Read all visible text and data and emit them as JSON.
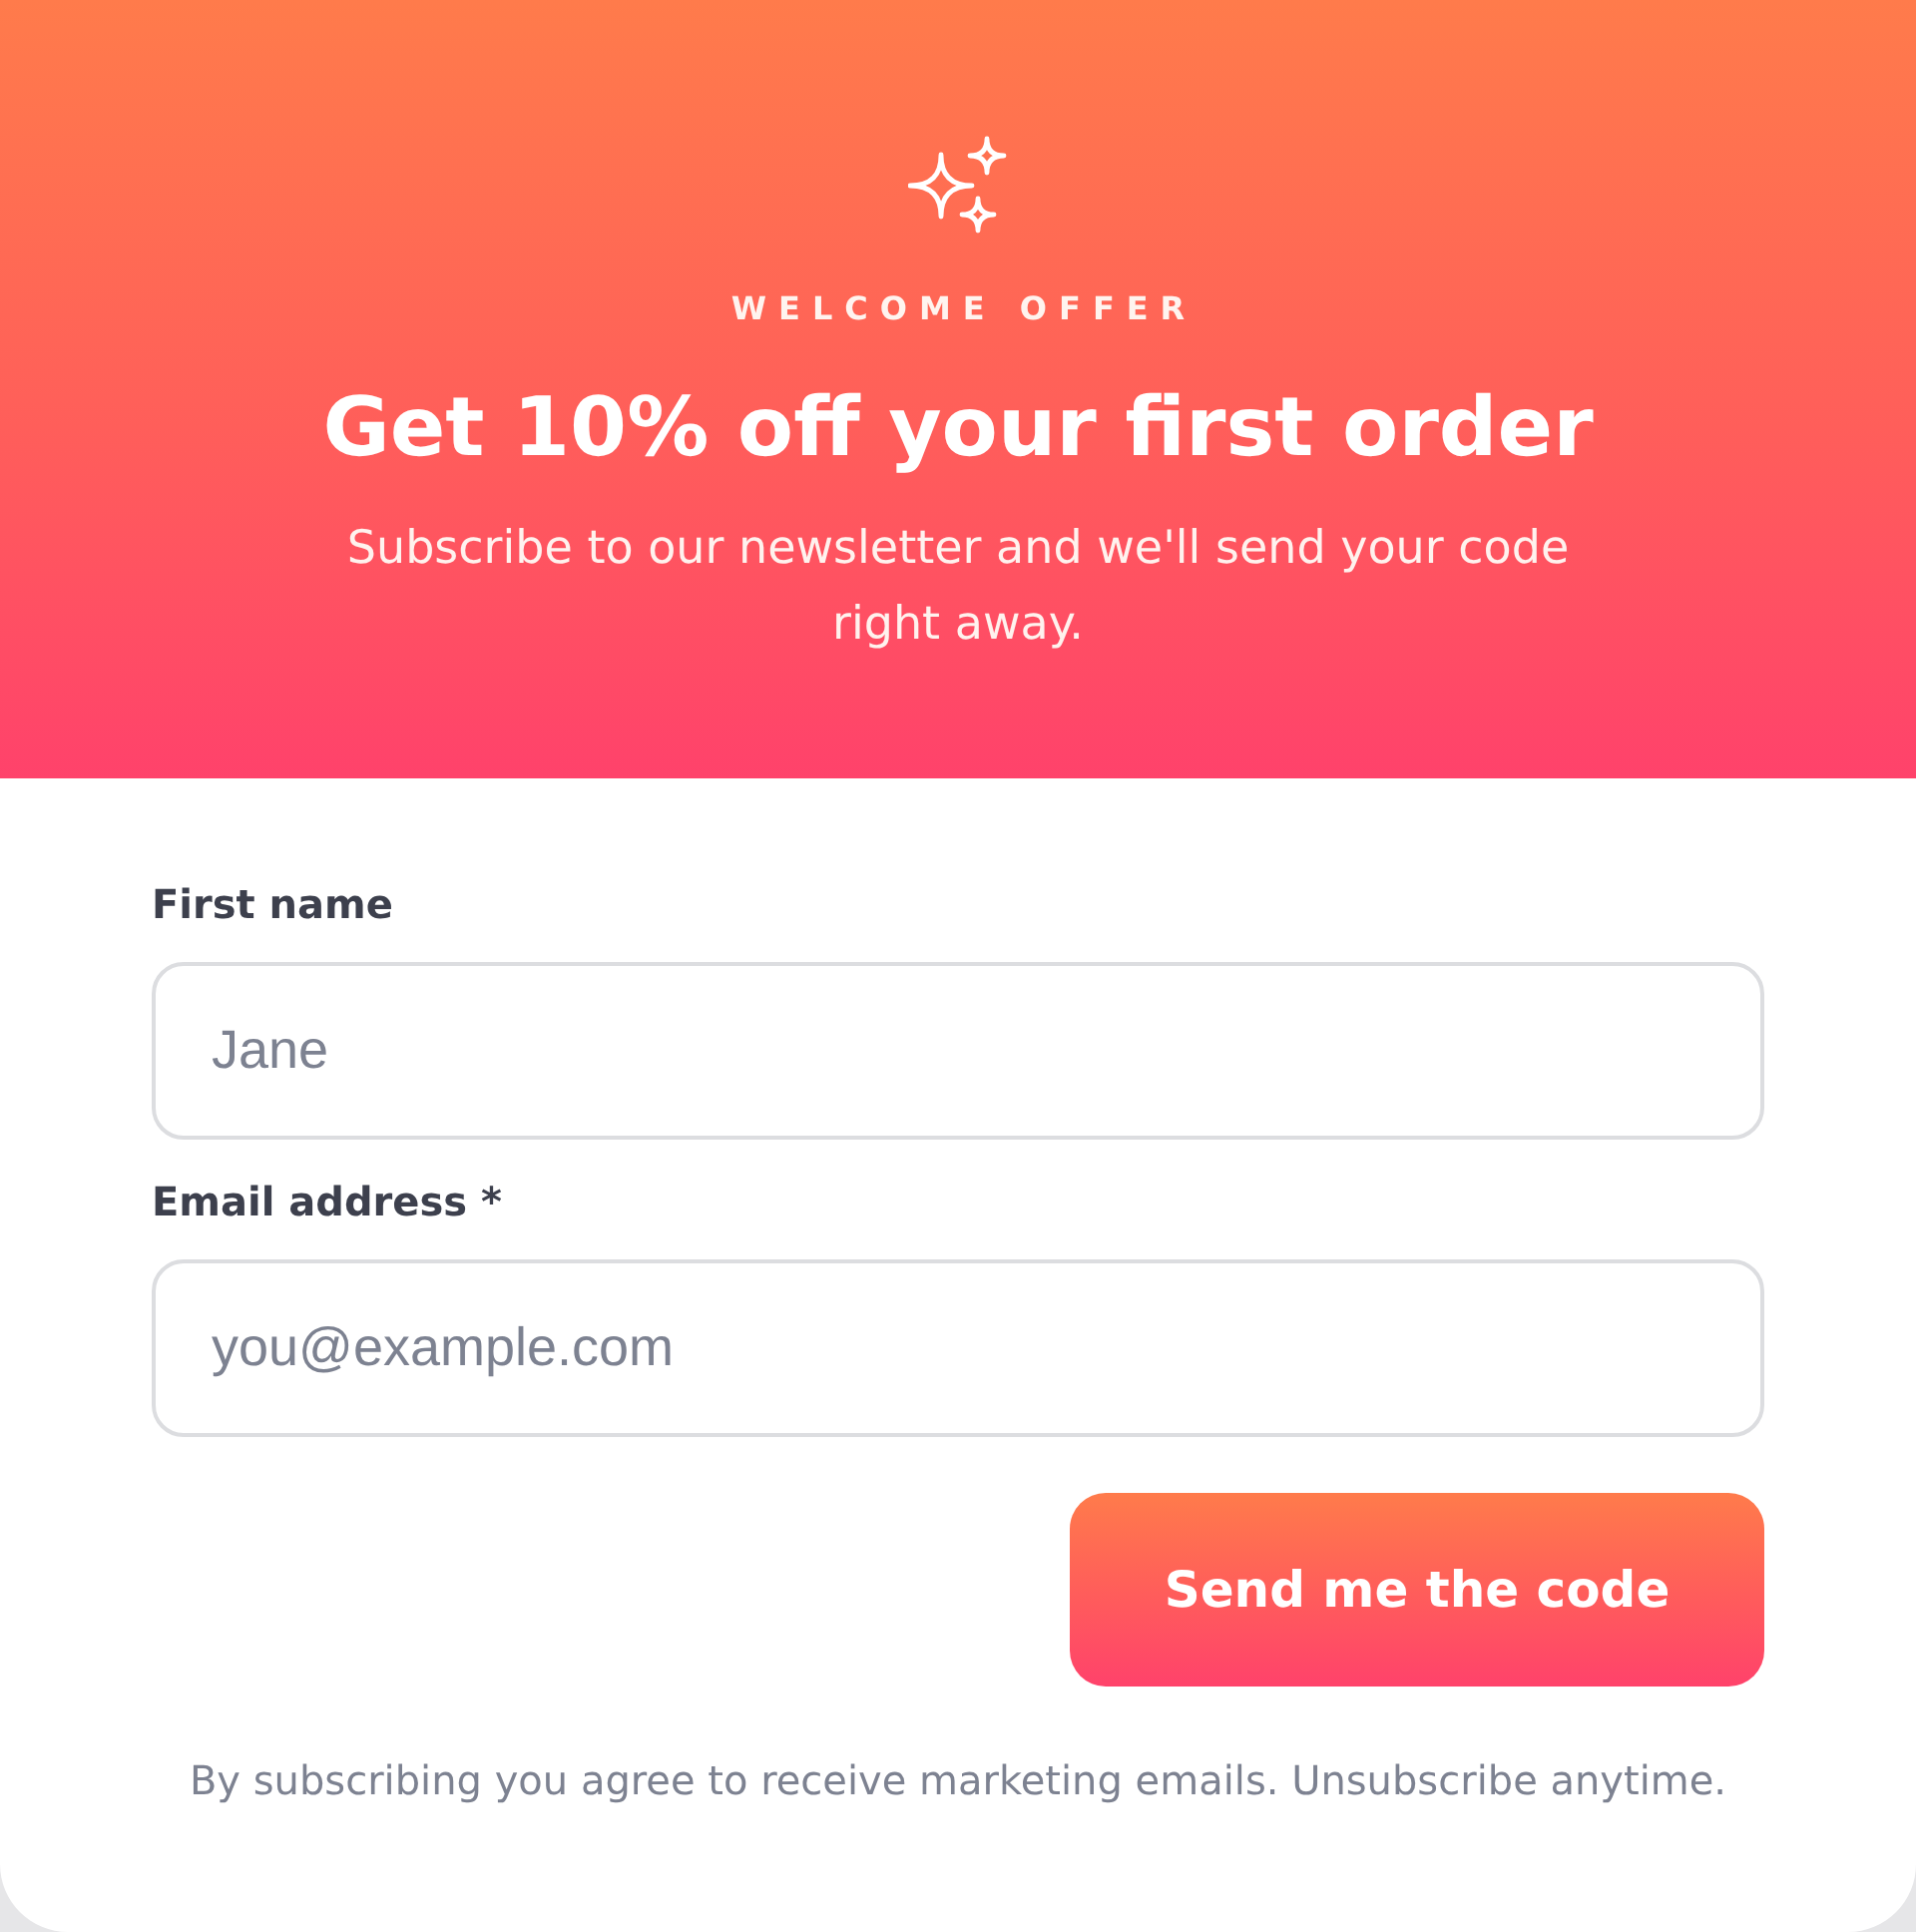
{
  "header": {
    "badge": "WELCOME OFFER",
    "title": "Get 10% off your first order",
    "subtitle": "Subscribe to our newsletter and we'll send your code right away."
  },
  "form": {
    "fields": [
      {
        "label": "First name",
        "placeholder": "Jane"
      },
      {
        "label": "Email address *",
        "placeholder": "you@example.com"
      }
    ],
    "submit": "Send me the code",
    "disclaimer": "By subscribing you agree to receive marketing emails. Unsubscribe anytime."
  }
}
